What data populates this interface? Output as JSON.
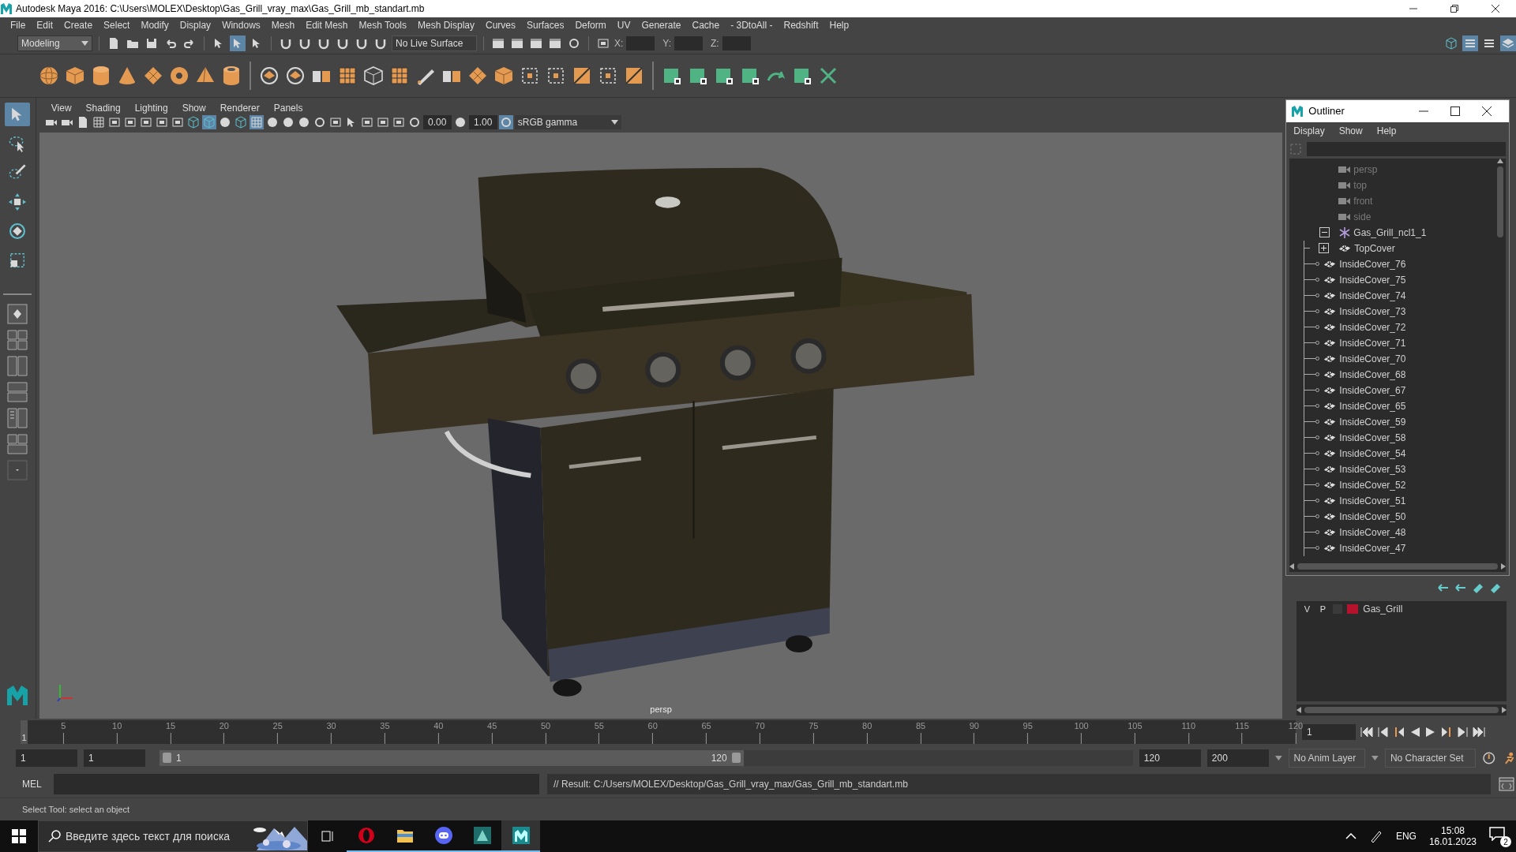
{
  "window": {
    "title": "Autodesk Maya 2016: C:\\Users\\MOLEX\\Desktop\\Gas_Grill_vray_max\\Gas_Grill_mb_standart.mb"
  },
  "menu_bar": [
    "File",
    "Edit",
    "Create",
    "Select",
    "Modify",
    "Display",
    "Windows",
    "Mesh",
    "Edit Mesh",
    "Mesh Tools",
    "Mesh Display",
    "Curves",
    "Surfaces",
    "Deform",
    "UV",
    "Generate",
    "Cache",
    "- 3DtoAll -",
    "Redshift",
    "Help"
  ],
  "status_line": {
    "mode": "Modeling",
    "live_surface": "No Live Surface",
    "x_label": "X:",
    "y_label": "Y:",
    "z_label": "Z:"
  },
  "toolbox": [
    {
      "kind": "select",
      "selected": true
    },
    {
      "kind": "lasso",
      "selected": false
    },
    {
      "kind": "paint",
      "selected": false
    },
    {
      "kind": "move",
      "selected": false
    },
    {
      "kind": "rotate",
      "selected": false
    },
    {
      "kind": "scale",
      "selected": false
    }
  ],
  "panel_menu": [
    "View",
    "Shading",
    "Lighting",
    "Show",
    "Renderer",
    "Panels"
  ],
  "panel_toolbar": {
    "near": "0.00",
    "far": "1.00",
    "color_space": "sRGB gamma"
  },
  "viewport": {
    "camera": "persp"
  },
  "outliner": {
    "title": "Outliner",
    "menu": [
      "Display",
      "Show",
      "Help"
    ],
    "items": [
      {
        "label": "persp",
        "kind": "camera"
      },
      {
        "label": "top",
        "kind": "camera"
      },
      {
        "label": "front",
        "kind": "camera"
      },
      {
        "label": "side",
        "kind": "camera"
      },
      {
        "label": "Gas_Grill_ncl1_1",
        "kind": "group",
        "expanded": true,
        "children": [
          {
            "label": "TopCover",
            "kind": "mesh",
            "expanded": false
          },
          {
            "label": "InsideCover_76",
            "kind": "mesh"
          },
          {
            "label": "InsideCover_75",
            "kind": "mesh"
          },
          {
            "label": "InsideCover_74",
            "kind": "mesh"
          },
          {
            "label": "InsideCover_73",
            "kind": "mesh"
          },
          {
            "label": "InsideCover_72",
            "kind": "mesh"
          },
          {
            "label": "InsideCover_71",
            "kind": "mesh"
          },
          {
            "label": "InsideCover_70",
            "kind": "mesh"
          },
          {
            "label": "InsideCover_68",
            "kind": "mesh"
          },
          {
            "label": "InsideCover_67",
            "kind": "mesh"
          },
          {
            "label": "InsideCover_65",
            "kind": "mesh"
          },
          {
            "label": "InsideCover_59",
            "kind": "mesh"
          },
          {
            "label": "InsideCover_58",
            "kind": "mesh"
          },
          {
            "label": "InsideCover_54",
            "kind": "mesh"
          },
          {
            "label": "InsideCover_53",
            "kind": "mesh"
          },
          {
            "label": "InsideCover_52",
            "kind": "mesh"
          },
          {
            "label": "InsideCover_51",
            "kind": "mesh"
          },
          {
            "label": "InsideCover_50",
            "kind": "mesh"
          },
          {
            "label": "InsideCover_48",
            "kind": "mesh"
          },
          {
            "label": "InsideCover_47",
            "kind": "mesh"
          }
        ]
      }
    ]
  },
  "layer_editor": {
    "layers": [
      {
        "visibility": "V",
        "playback": "P",
        "name": "Gas_Grill",
        "color": "#b5122e"
      }
    ]
  },
  "time_slider": {
    "start_label": "1",
    "ticks": [
      "5",
      "10",
      "15",
      "20",
      "25",
      "30",
      "35",
      "40",
      "45",
      "50",
      "55",
      "60",
      "65",
      "70",
      "75",
      "80",
      "85",
      "90",
      "95",
      "100",
      "105",
      "110",
      "115",
      "120"
    ],
    "current_frame": "1"
  },
  "range_slider": {
    "level": 0.6,
    "start": "1",
    "playback_start": "1",
    "range_start": "1",
    "range_end": "120",
    "playback_end": "120",
    "end": "200",
    "anim_layer": "No Anim Layer",
    "character_set": "No Character Set"
  },
  "command_line": {
    "language": "MEL",
    "result": "// Result: C:/Users/MOLEX/Desktop/Gas_Grill_vray_max/Gas_Grill_mb_standart.mb"
  },
  "help_line": "Select Tool: select an object",
  "taskbar": {
    "search_placeholder": "Введите здесь текст для поиска",
    "language": "ENG",
    "time": "15:08",
    "date": "16.01.2023",
    "notifications": "2"
  }
}
